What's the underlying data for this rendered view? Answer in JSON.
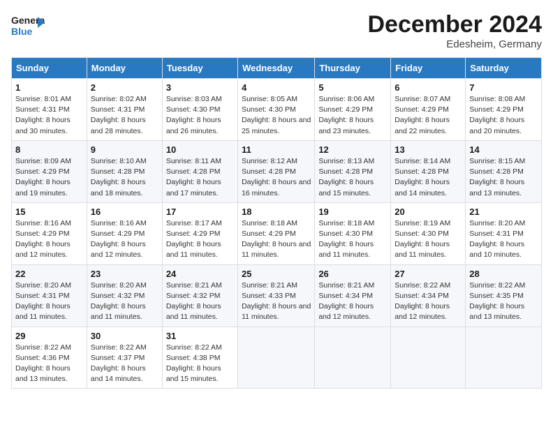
{
  "logo": {
    "line1": "General",
    "line2": "Blue"
  },
  "title": "December 2024",
  "location": "Edesheim, Germany",
  "days_of_week": [
    "Sunday",
    "Monday",
    "Tuesday",
    "Wednesday",
    "Thursday",
    "Friday",
    "Saturday"
  ],
  "weeks": [
    [
      {
        "day": 1,
        "sunrise": "8:01 AM",
        "sunset": "4:31 PM",
        "daylight": "8 hours and 30 minutes."
      },
      {
        "day": 2,
        "sunrise": "8:02 AM",
        "sunset": "4:31 PM",
        "daylight": "8 hours and 28 minutes."
      },
      {
        "day": 3,
        "sunrise": "8:03 AM",
        "sunset": "4:30 PM",
        "daylight": "8 hours and 26 minutes."
      },
      {
        "day": 4,
        "sunrise": "8:05 AM",
        "sunset": "4:30 PM",
        "daylight": "8 hours and 25 minutes."
      },
      {
        "day": 5,
        "sunrise": "8:06 AM",
        "sunset": "4:29 PM",
        "daylight": "8 hours and 23 minutes."
      },
      {
        "day": 6,
        "sunrise": "8:07 AM",
        "sunset": "4:29 PM",
        "daylight": "8 hours and 22 minutes."
      },
      {
        "day": 7,
        "sunrise": "8:08 AM",
        "sunset": "4:29 PM",
        "daylight": "8 hours and 20 minutes."
      }
    ],
    [
      {
        "day": 8,
        "sunrise": "8:09 AM",
        "sunset": "4:29 PM",
        "daylight": "8 hours and 19 minutes."
      },
      {
        "day": 9,
        "sunrise": "8:10 AM",
        "sunset": "4:28 PM",
        "daylight": "8 hours and 18 minutes."
      },
      {
        "day": 10,
        "sunrise": "8:11 AM",
        "sunset": "4:28 PM",
        "daylight": "8 hours and 17 minutes."
      },
      {
        "day": 11,
        "sunrise": "8:12 AM",
        "sunset": "4:28 PM",
        "daylight": "8 hours and 16 minutes."
      },
      {
        "day": 12,
        "sunrise": "8:13 AM",
        "sunset": "4:28 PM",
        "daylight": "8 hours and 15 minutes."
      },
      {
        "day": 13,
        "sunrise": "8:14 AM",
        "sunset": "4:28 PM",
        "daylight": "8 hours and 14 minutes."
      },
      {
        "day": 14,
        "sunrise": "8:15 AM",
        "sunset": "4:28 PM",
        "daylight": "8 hours and 13 minutes."
      }
    ],
    [
      {
        "day": 15,
        "sunrise": "8:16 AM",
        "sunset": "4:29 PM",
        "daylight": "8 hours and 12 minutes."
      },
      {
        "day": 16,
        "sunrise": "8:16 AM",
        "sunset": "4:29 PM",
        "daylight": "8 hours and 12 minutes."
      },
      {
        "day": 17,
        "sunrise": "8:17 AM",
        "sunset": "4:29 PM",
        "daylight": "8 hours and 11 minutes."
      },
      {
        "day": 18,
        "sunrise": "8:18 AM",
        "sunset": "4:29 PM",
        "daylight": "8 hours and 11 minutes."
      },
      {
        "day": 19,
        "sunrise": "8:18 AM",
        "sunset": "4:30 PM",
        "daylight": "8 hours and 11 minutes."
      },
      {
        "day": 20,
        "sunrise": "8:19 AM",
        "sunset": "4:30 PM",
        "daylight": "8 hours and 11 minutes."
      },
      {
        "day": 21,
        "sunrise": "8:20 AM",
        "sunset": "4:31 PM",
        "daylight": "8 hours and 10 minutes."
      }
    ],
    [
      {
        "day": 22,
        "sunrise": "8:20 AM",
        "sunset": "4:31 PM",
        "daylight": "8 hours and 11 minutes."
      },
      {
        "day": 23,
        "sunrise": "8:20 AM",
        "sunset": "4:32 PM",
        "daylight": "8 hours and 11 minutes."
      },
      {
        "day": 24,
        "sunrise": "8:21 AM",
        "sunset": "4:32 PM",
        "daylight": "8 hours and 11 minutes."
      },
      {
        "day": 25,
        "sunrise": "8:21 AM",
        "sunset": "4:33 PM",
        "daylight": "8 hours and 11 minutes."
      },
      {
        "day": 26,
        "sunrise": "8:21 AM",
        "sunset": "4:34 PM",
        "daylight": "8 hours and 12 minutes."
      },
      {
        "day": 27,
        "sunrise": "8:22 AM",
        "sunset": "4:34 PM",
        "daylight": "8 hours and 12 minutes."
      },
      {
        "day": 28,
        "sunrise": "8:22 AM",
        "sunset": "4:35 PM",
        "daylight": "8 hours and 13 minutes."
      }
    ],
    [
      {
        "day": 29,
        "sunrise": "8:22 AM",
        "sunset": "4:36 PM",
        "daylight": "8 hours and 13 minutes."
      },
      {
        "day": 30,
        "sunrise": "8:22 AM",
        "sunset": "4:37 PM",
        "daylight": "8 hours and 14 minutes."
      },
      {
        "day": 31,
        "sunrise": "8:22 AM",
        "sunset": "4:38 PM",
        "daylight": "8 hours and 15 minutes."
      },
      null,
      null,
      null,
      null
    ]
  ]
}
